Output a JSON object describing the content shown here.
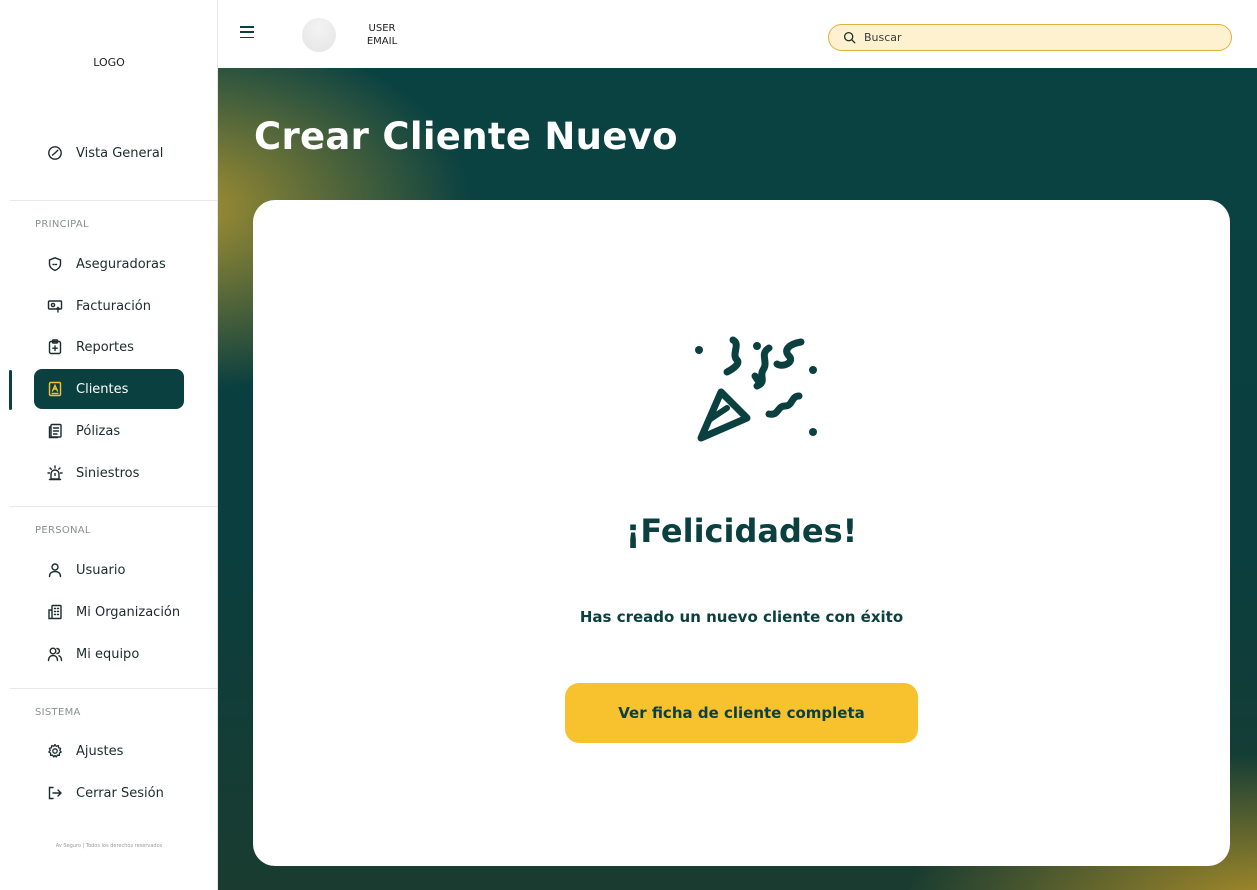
{
  "sidebar": {
    "logo": "LOGO",
    "overview": "Vista General",
    "sections": {
      "principal": "PRINCIPAL",
      "personal": "PERSONAL",
      "sistema": "SISTEMA"
    },
    "items": {
      "aseguradoras": "Aseguradoras",
      "facturacion": "Facturación",
      "reportes": "Reportes",
      "clientes": "Clientes",
      "polizas": "Pólizas",
      "siniestros": "Siniestros",
      "usuario": "Usuario",
      "organizacion": "Mi Organización",
      "equipo": "Mi equipo",
      "ajustes": "Ajustes",
      "cerrar_sesion": "Cerrar Sesión"
    },
    "active_item": "Clientes",
    "footer": "Av Seguro | Todos los derechos reservados"
  },
  "topbar": {
    "user_line1": "USER",
    "user_line2": "EMAIL",
    "search_placeholder": "Buscar"
  },
  "main": {
    "title": "Crear Cliente Nuevo",
    "card": {
      "headline": "¡Felicidades!",
      "message": "Has creado un nuevo cliente con éxito",
      "button_label": "Ver ficha de cliente completa"
    }
  },
  "colors": {
    "brand_dark": "#0b4040",
    "accent_yellow": "#f8c22e",
    "search_bg": "#fdf1cf"
  }
}
